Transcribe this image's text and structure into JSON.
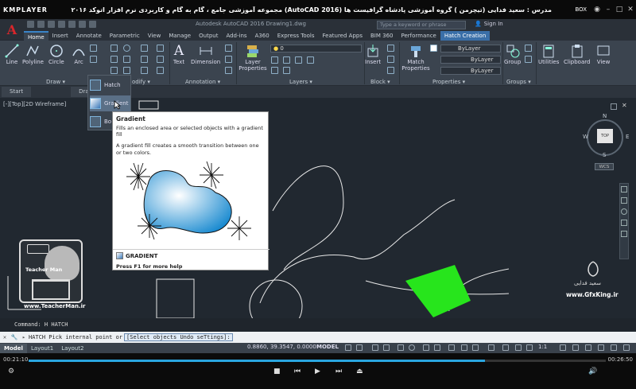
{
  "player": {
    "logo": "KMPLAYER",
    "title": "مجموعه آموزشی جامع ، گام به گام و کاربردی نرم افزار اتوکد ۲۰۱۶ (AutoCAD 2016) مدرس : سعید فدایی (تیچرمن ) گروه آموزشی پادشاه گرافیست ها",
    "box_label": "BOX",
    "time_current": "00:21:10",
    "time_total": "00:26:50",
    "progress_fraction": 0.79
  },
  "acad": {
    "window_title": "Autodesk AutoCAD 2016   Drawing1.dwg",
    "search_placeholder": "Type a keyword or phrase",
    "sign_in": "Sign In",
    "tabs": [
      {
        "label": "Home",
        "active": true
      },
      {
        "label": "Insert"
      },
      {
        "label": "Annotate"
      },
      {
        "label": "Parametric"
      },
      {
        "label": "View"
      },
      {
        "label": "Manage"
      },
      {
        "label": "Output"
      },
      {
        "label": "Add-ins"
      },
      {
        "label": "A360"
      },
      {
        "label": "Express Tools"
      },
      {
        "label": "Featured Apps"
      },
      {
        "label": "BIM 360"
      },
      {
        "label": "Performance"
      },
      {
        "label": "Hatch Creation",
        "highlight": true
      }
    ]
  },
  "ribbon": {
    "tools": {
      "line": "Line",
      "polyline": "Polyline",
      "circle": "Circle",
      "arc": "Arc",
      "text": "Text",
      "dimension": "Dimension",
      "layer_properties": "Layer Properties",
      "insert": "Insert",
      "match_properties": "Match Properties",
      "group": "Group",
      "utilities": "Utilities",
      "clipboard": "Clipboard",
      "view": "View"
    },
    "groups": {
      "draw": "Draw",
      "modify": "odify",
      "annotation": "Annotation",
      "layers": "Layers",
      "block": "Block",
      "properties": "Properties",
      "groups": "Groups"
    },
    "layer_value": "0",
    "bylayer1": "ByLayer",
    "bylayer2": "ByLayer",
    "bylayer3": "ByLayer"
  },
  "file_tabs": [
    "Start",
    "Draw"
  ],
  "viewport_label": "[-][Top][2D Wireframe]",
  "dropdown": {
    "items": [
      {
        "label": "Hatch"
      },
      {
        "label": "Gradient",
        "highlighted": true
      },
      {
        "label": "Bo"
      }
    ]
  },
  "tooltip": {
    "title": "Gradient",
    "desc1": "Fills an enclosed area or selected objects with a gradient fill",
    "desc2": "A gradient fill creates a smooth transition between one or two colors.",
    "command": "GRADIENT",
    "help": "Press F1 for more help"
  },
  "viewcube": {
    "top": "TOP",
    "n": "N",
    "s": "S",
    "e": "E",
    "w": "W",
    "wcs": "WCS"
  },
  "watermark": {
    "site_left": "www.TeacherMan.ir",
    "badge": "Teacher Man",
    "name_right": "سعید فدایی",
    "site_right": "www.GfxKing.ir"
  },
  "command": {
    "history": "Command: H HATCH",
    "prompt": "HATCH Pick internal point or",
    "options": "[Select objects Undo seTtings]:"
  },
  "status": {
    "tabs": [
      {
        "label": "Model",
        "active": true
      },
      {
        "label": "Layout1"
      },
      {
        "label": "Layout2"
      }
    ],
    "coords": "0.8860, 39.3547, 0.0000",
    "model": "MODEL",
    "scale": "1:1"
  },
  "colors": {
    "accent": "#3a84c8",
    "hatch_green": "#27e51c",
    "autocad_red": "#d8262b"
  }
}
